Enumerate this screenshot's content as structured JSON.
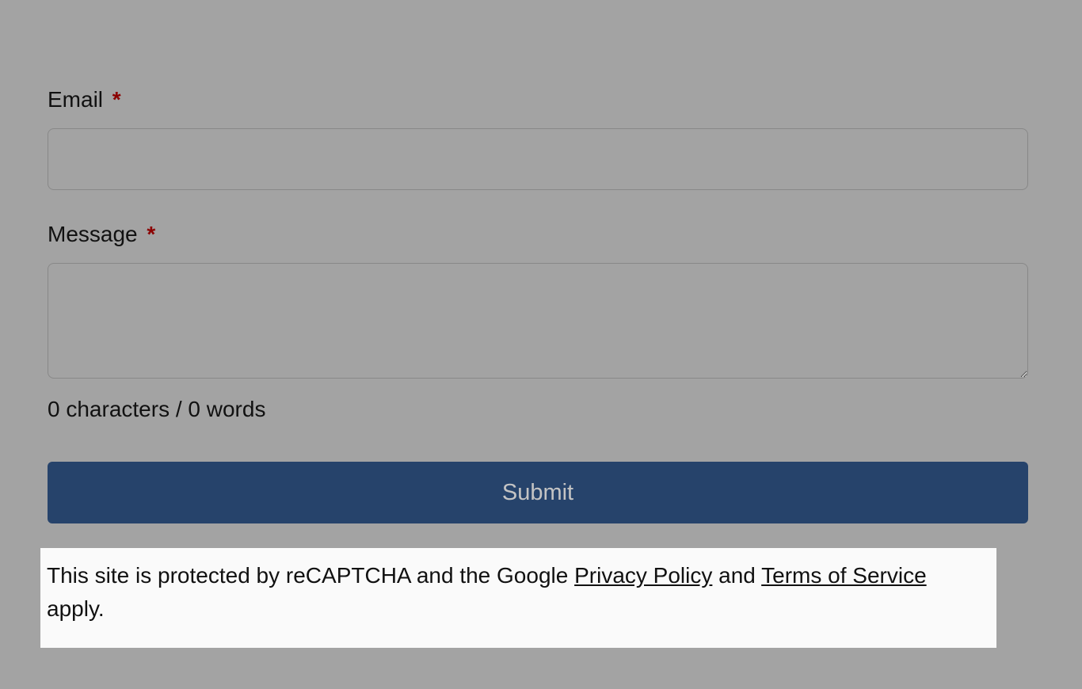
{
  "form": {
    "email": {
      "label": "Email",
      "required_marker": "*",
      "value": ""
    },
    "message": {
      "label": "Message",
      "required_marker": "*",
      "value": "",
      "counter": "0 characters / 0 words"
    },
    "submit_label": "Submit"
  },
  "recaptcha": {
    "prefix": "This site is protected by reCAPTCHA and the Google ",
    "privacy_link": "Privacy Policy",
    "mid": " and ",
    "terms_link": "Terms of Service",
    "suffix": " apply."
  }
}
